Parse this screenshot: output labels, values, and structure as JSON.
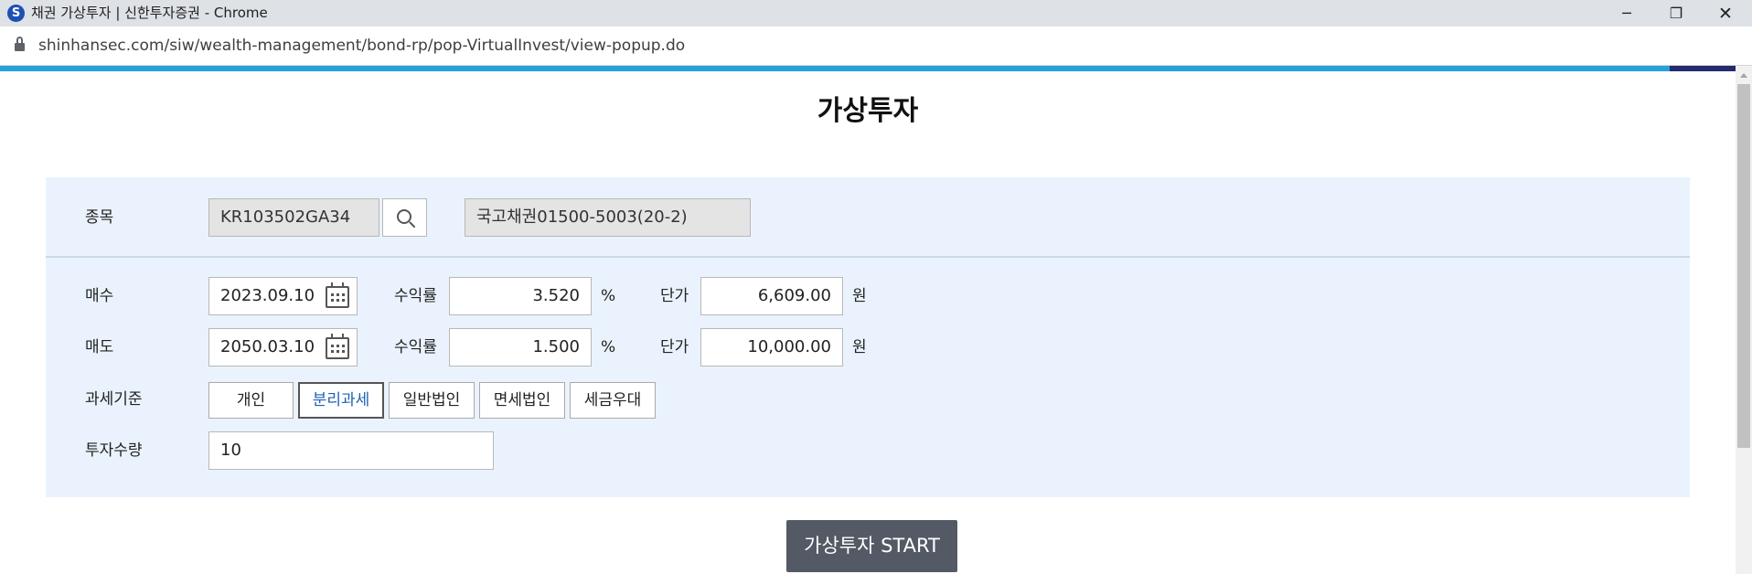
{
  "window": {
    "title": "채권 가상투자 | 신한투자증권 - Chrome",
    "logo": "S",
    "minimize": "─",
    "maximize": "❐",
    "close": "✕"
  },
  "browser": {
    "url": "shinhansec.com/siw/wealth-management/bond-rp/pop-VirtualInvest/view-popup.do"
  },
  "page": {
    "title": "가상투자"
  },
  "form": {
    "item": {
      "label": "종목",
      "code": "KR103502GA34",
      "name": "국고채권01500-5003(20-2)"
    },
    "buy": {
      "label": "매수",
      "date": "2023.09.10",
      "yield_label": "수익률",
      "yield": "3.520",
      "yield_unit": "%",
      "price_label": "단가",
      "price": "6,609.00",
      "price_unit": "원"
    },
    "sell": {
      "label": "매도",
      "date": "2050.03.10",
      "yield_label": "수익률",
      "yield": "1.500",
      "yield_unit": "%",
      "price_label": "단가",
      "price": "10,000.00",
      "price_unit": "원"
    },
    "tax": {
      "label": "과세기준",
      "options": [
        "개인",
        "분리과세",
        "일반법인",
        "면세법인",
        "세금우대"
      ],
      "selected": "분리과세"
    },
    "quantity": {
      "label": "투자수량",
      "value": "10"
    }
  },
  "start_button": "가상투자 START",
  "colors": {
    "accent_stripe": "#27a1db",
    "panel_bg": "#eaf3fd",
    "selected_text": "#1e62b5",
    "start_button_bg": "#535a66"
  }
}
